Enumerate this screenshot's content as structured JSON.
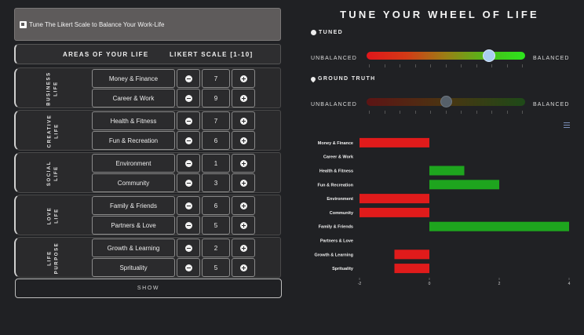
{
  "banner": {
    "text": "Tune The Likert Scale to Balance Your Work-Life"
  },
  "table": {
    "col_areas": "AREAS OF YOUR LIFE",
    "col_scale": "LIKERT SCALE [1-10]"
  },
  "groups": [
    {
      "label": "BUSINESS\nLIFE",
      "rows": [
        {
          "name": "Money & Finance",
          "value": "7"
        },
        {
          "name": "Career & Work",
          "value": "9"
        }
      ]
    },
    {
      "label": "CREATIVE\nLIFE",
      "rows": [
        {
          "name": "Health & Fitness",
          "value": "7"
        },
        {
          "name": "Fun & Recreation",
          "value": "6"
        }
      ]
    },
    {
      "label": "SOCIAL\nLIFE",
      "rows": [
        {
          "name": "Environment",
          "value": "1"
        },
        {
          "name": "Community",
          "value": "3"
        }
      ]
    },
    {
      "label": "LOVE\nLIFE",
      "rows": [
        {
          "name": "Family & Friends",
          "value": "6"
        },
        {
          "name": "Partners & Love",
          "value": "5"
        }
      ]
    },
    {
      "label": "LIFE\nPURPOSE",
      "rows": [
        {
          "name": "Growth & Learning",
          "value": "2"
        },
        {
          "name": "Sprituality",
          "value": "5"
        }
      ]
    }
  ],
  "show_button": "SHOW",
  "right": {
    "title": "TUNE YOUR WHEEL OF LIFE",
    "tuned_label": "TUNED",
    "truth_label": "GROUND TRUTH",
    "unbalanced": "UNBALANCED",
    "balanced": "BALANCED",
    "tuned_level": 0.77,
    "truth_level": 0.5,
    "icons": {
      "tuned": "dashboard-icon",
      "truth": "map-pin-icon",
      "menu": "hamburger-menu-icon"
    }
  },
  "colors": {
    "negative": "#e01b1b",
    "positive": "#1ea51e",
    "accent": "#a9cdf0"
  },
  "chart_data": {
    "type": "bar",
    "orientation": "horizontal",
    "categories": [
      "Money & Finance",
      "Career & Work",
      "Health & Fitness",
      "Fun & Recreation",
      "Environment",
      "Community",
      "Family & Friends",
      "Partners & Love",
      "Growth & Learning",
      "Sprituality"
    ],
    "values": [
      -2,
      0,
      1,
      2,
      -2,
      -2,
      4,
      0,
      -1,
      -1
    ],
    "xlim": [
      -2,
      4
    ],
    "xticks": [
      "-2",
      "0",
      "2",
      "4"
    ]
  }
}
